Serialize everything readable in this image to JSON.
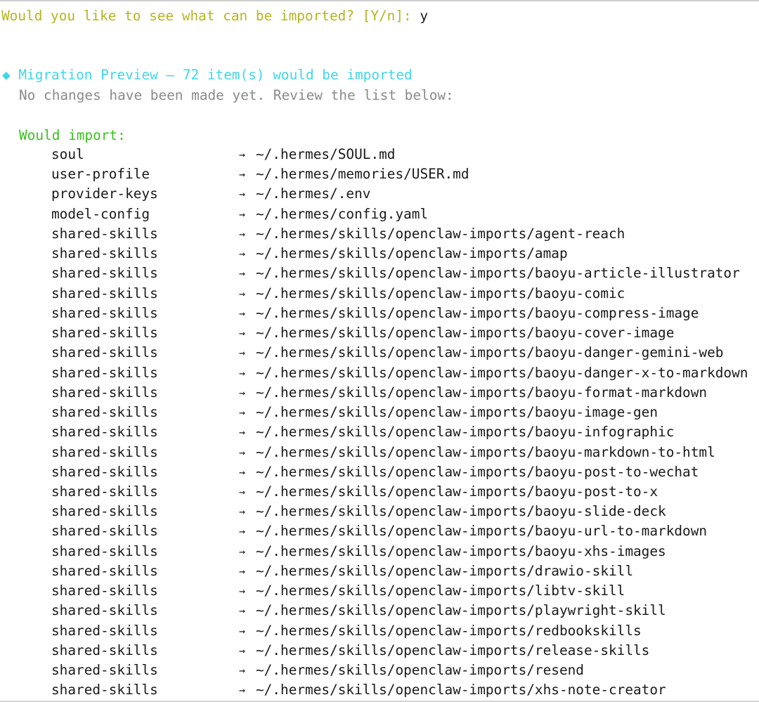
{
  "prompt": {
    "question": "Would you like to see what can be imported? [Y/n]: ",
    "answer": "y"
  },
  "preview": {
    "header": "◆ Migration Preview — 72 item(s) would be imported",
    "subtitle": "No changes have been made yet. Review the list below:",
    "section_label": "Would import:",
    "arrow_glyph": "→",
    "items": [
      {
        "name": "soul",
        "dest": "~/.hermes/SOUL.md"
      },
      {
        "name": "user-profile",
        "dest": "~/.hermes/memories/USER.md"
      },
      {
        "name": "provider-keys",
        "dest": "~/.hermes/.env"
      },
      {
        "name": "model-config",
        "dest": "~/.hermes/config.yaml"
      },
      {
        "name": "shared-skills",
        "dest": "~/.hermes/skills/openclaw-imports/agent-reach"
      },
      {
        "name": "shared-skills",
        "dest": "~/.hermes/skills/openclaw-imports/amap"
      },
      {
        "name": "shared-skills",
        "dest": "~/.hermes/skills/openclaw-imports/baoyu-article-illustrator"
      },
      {
        "name": "shared-skills",
        "dest": "~/.hermes/skills/openclaw-imports/baoyu-comic"
      },
      {
        "name": "shared-skills",
        "dest": "~/.hermes/skills/openclaw-imports/baoyu-compress-image"
      },
      {
        "name": "shared-skills",
        "dest": "~/.hermes/skills/openclaw-imports/baoyu-cover-image"
      },
      {
        "name": "shared-skills",
        "dest": "~/.hermes/skills/openclaw-imports/baoyu-danger-gemini-web"
      },
      {
        "name": "shared-skills",
        "dest": "~/.hermes/skills/openclaw-imports/baoyu-danger-x-to-markdown"
      },
      {
        "name": "shared-skills",
        "dest": "~/.hermes/skills/openclaw-imports/baoyu-format-markdown"
      },
      {
        "name": "shared-skills",
        "dest": "~/.hermes/skills/openclaw-imports/baoyu-image-gen"
      },
      {
        "name": "shared-skills",
        "dest": "~/.hermes/skills/openclaw-imports/baoyu-infographic"
      },
      {
        "name": "shared-skills",
        "dest": "~/.hermes/skills/openclaw-imports/baoyu-markdown-to-html"
      },
      {
        "name": "shared-skills",
        "dest": "~/.hermes/skills/openclaw-imports/baoyu-post-to-wechat"
      },
      {
        "name": "shared-skills",
        "dest": "~/.hermes/skills/openclaw-imports/baoyu-post-to-x"
      },
      {
        "name": "shared-skills",
        "dest": "~/.hermes/skills/openclaw-imports/baoyu-slide-deck"
      },
      {
        "name": "shared-skills",
        "dest": "~/.hermes/skills/openclaw-imports/baoyu-url-to-markdown"
      },
      {
        "name": "shared-skills",
        "dest": "~/.hermes/skills/openclaw-imports/baoyu-xhs-images"
      },
      {
        "name": "shared-skills",
        "dest": "~/.hermes/skills/openclaw-imports/drawio-skill"
      },
      {
        "name": "shared-skills",
        "dest": "~/.hermes/skills/openclaw-imports/libtv-skill"
      },
      {
        "name": "shared-skills",
        "dest": "~/.hermes/skills/openclaw-imports/playwright-skill"
      },
      {
        "name": "shared-skills",
        "dest": "~/.hermes/skills/openclaw-imports/redbookskills"
      },
      {
        "name": "shared-skills",
        "dest": "~/.hermes/skills/openclaw-imports/release-skills"
      },
      {
        "name": "shared-skills",
        "dest": "~/.hermes/skills/openclaw-imports/resend"
      },
      {
        "name": "shared-skills",
        "dest": "~/.hermes/skills/openclaw-imports/xhs-note-creator"
      }
    ]
  },
  "colors": {
    "prompt": "#b5b51f",
    "header": "#3fd7e6",
    "subtitle": "#8a8a8a",
    "section": "#38c21c",
    "text": "#1a1a1a",
    "background": "#ffffff"
  }
}
